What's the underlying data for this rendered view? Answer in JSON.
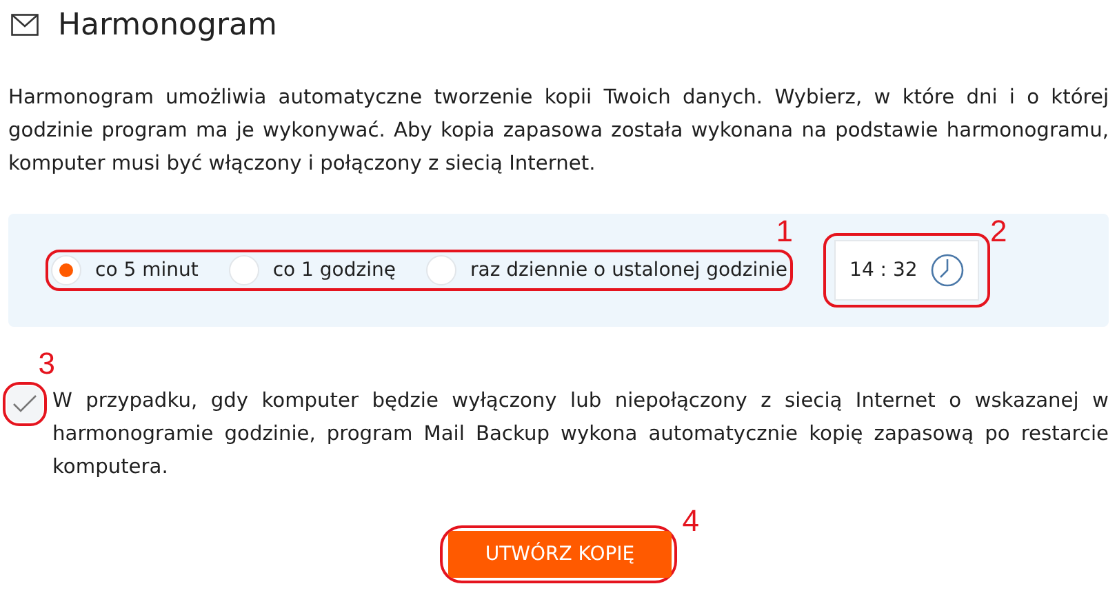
{
  "header": {
    "title": "Harmonogram"
  },
  "description": "Harmonogram umożliwia automatyczne tworzenie kopii Twoich danych. Wybierz, w które dni i o której godzinie program ma je wykonywać. Aby kopia zapasowa została wykonana na podstawie harmonogramu, komputer musi być włączony i połączony z siecią Internet.",
  "schedule": {
    "options": [
      {
        "label": "co 5 minut",
        "selected": true
      },
      {
        "label": "co 1 godzinę",
        "selected": false
      },
      {
        "label": "raz dziennie o ustalonej godzinie",
        "selected": false
      }
    ],
    "time": {
      "value": "14 : 32"
    }
  },
  "fallback": {
    "checked": true,
    "text": "W przypadku, gdy komputer będzie wyłączony lub niepołączony z siecią Internet o wskazanej w harmonogramie godzinie, program Mail Backup wykona automatycznie kopię zapasową po restarcie komputera."
  },
  "button": {
    "label": "UTWÓRZ KOPIĘ"
  },
  "callouts": [
    "1",
    "2",
    "3",
    "4"
  ]
}
